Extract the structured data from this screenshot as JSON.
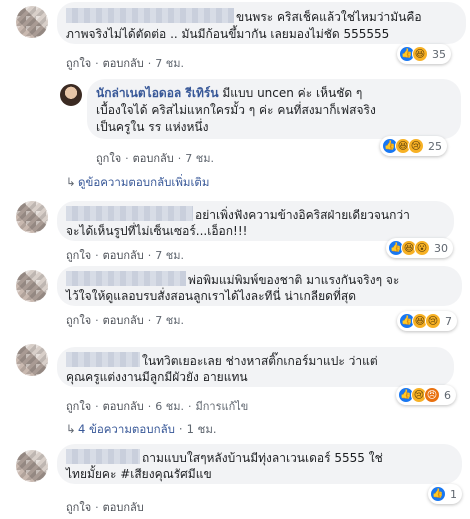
{
  "common": {
    "like": "ถูกใจ",
    "reply": "ตอบกลับ",
    "sep": "·"
  },
  "comments": [
    {
      "line1": "ขนพระ คริสเช็คแล้วใช่ไหมว่ามันคือ",
      "line2": "ภาพจริงไม่ได้ตัดต่อ .. มันมีก้อนขึ้มากัน เลยมองไม่ชัด 555555",
      "time": "7 ชม.",
      "count": "35"
    },
    {
      "author": "นักล่าเนตไอดอล รีเทิร์น",
      "line1": "มีแบบ uncen ค่ะ เห็นชัด ๆ",
      "line2": "เบื้องใจได้ คริสไม่แหกใครมั้ว ๆ ค่ะ คนที่สงมาก็เฟสจริง",
      "line3": "เป็นครูใน รร แห่งหนึ่ง",
      "time": "7 ชม.",
      "count": "25"
    },
    {
      "more": "ดูข้อความตอบกลับเพิ่มเติม"
    },
    {
      "line1": "อย่าเพิ่งฟังความข้างอิคริสฝ่ายเดียวจนกว่า",
      "line2": "จะได้เห็นรูปที่ไม่เซ็นเซอร์...เอ็อก!!!",
      "time": "7 ชม.",
      "count": "30"
    },
    {
      "line1": "พ่อพิมแม่พิมพ์ของชาติ มาแรงกันจริงๆ จะ",
      "line2": "ไว้ใจให้ดูแลอบรบสั่งสอนลูกเราได้ไงละทีนี่ น่าเกลียดที่สุด",
      "time": "7 ชม.",
      "count": "7"
    },
    {
      "line1": "ในทวิตเยอะเลย ช่างหาสติ๊กเกอร์มาแปะ ว่าแต่",
      "line2": "คุณครูแต่งงานมีลูกมีผัวยัง อายแทน",
      "time": "6 ชม.",
      "edited": "มีการแก้ไข",
      "count": "6"
    },
    {
      "more": "4 ข้อความตอบกลับ",
      "time": "1 ชม."
    },
    {
      "line1": "ถามแบบใสๆหลังบ้านมีทุ่งลาเวนเดอร์ 5555 ใช่",
      "line2": "ไทยมั้ยคะ #เสียงคุณรัศมีแข",
      "count": "1"
    }
  ]
}
